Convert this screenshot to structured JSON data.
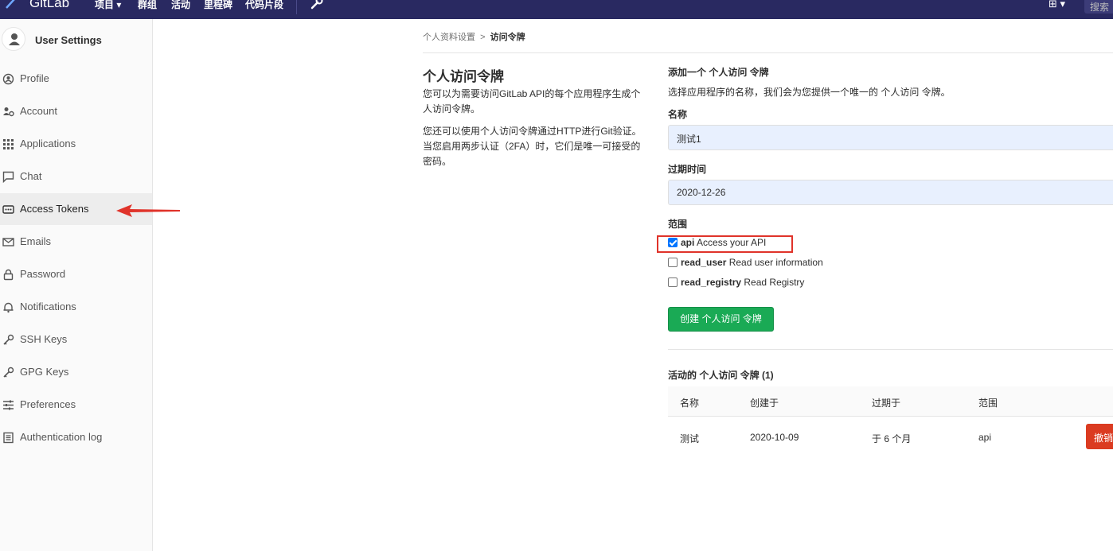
{
  "topbar": {
    "brand": "GitLab",
    "nav": [
      "项目",
      "群组",
      "活动",
      "里程碑",
      "代码片段"
    ],
    "search_placeholder": "搜索"
  },
  "sidebar": {
    "title": "User Settings",
    "items": [
      {
        "label": "Profile",
        "icon": "profile-icon"
      },
      {
        "label": "Account",
        "icon": "account-icon"
      },
      {
        "label": "Applications",
        "icon": "applications-icon"
      },
      {
        "label": "Chat",
        "icon": "chat-icon"
      },
      {
        "label": "Access Tokens",
        "icon": "token-icon",
        "active": true
      },
      {
        "label": "Emails",
        "icon": "mail-icon"
      },
      {
        "label": "Password",
        "icon": "lock-icon"
      },
      {
        "label": "Notifications",
        "icon": "bell-icon"
      },
      {
        "label": "SSH Keys",
        "icon": "key-icon"
      },
      {
        "label": "GPG Keys",
        "icon": "key-icon"
      },
      {
        "label": "Preferences",
        "icon": "preferences-icon"
      },
      {
        "label": "Authentication log",
        "icon": "log-icon"
      }
    ]
  },
  "breadcrumb": {
    "parent": "个人资料设置",
    "current": "访问令牌"
  },
  "intro": {
    "title": "个人访问令牌",
    "p1": "您可以为需要访问GitLab API的每个应用程序生成个人访问令牌。",
    "p2": "您还可以使用个人访问令牌通过HTTP进行Git验证。 当您启用两步认证（2FA）时，它们是唯一可接受的密码。"
  },
  "form": {
    "title": "添加一个 个人访问 令牌",
    "desc": "选择应用程序的名称，我们会为您提供一个唯一的 个人访问 令牌。",
    "name_label": "名称",
    "name_value": "测试1",
    "expires_label": "过期时间",
    "expires_value": "2020-12-26",
    "scopes_label": "范围",
    "scopes": [
      {
        "name": "api",
        "desc": "Access your API",
        "checked": true
      },
      {
        "name": "read_user",
        "desc": "Read user information",
        "checked": false
      },
      {
        "name": "read_registry",
        "desc": "Read Registry",
        "checked": false
      }
    ],
    "submit": "创建 个人访问 令牌"
  },
  "active_tokens": {
    "title": "活动的 个人访问 令牌 (1)",
    "headers": [
      "名称",
      "创建于",
      "过期于",
      "范围"
    ],
    "rows": [
      {
        "name": "测试",
        "created": "2020-10-09",
        "expires": "于 6 个月",
        "scope": "api",
        "action": "撤销"
      }
    ]
  }
}
